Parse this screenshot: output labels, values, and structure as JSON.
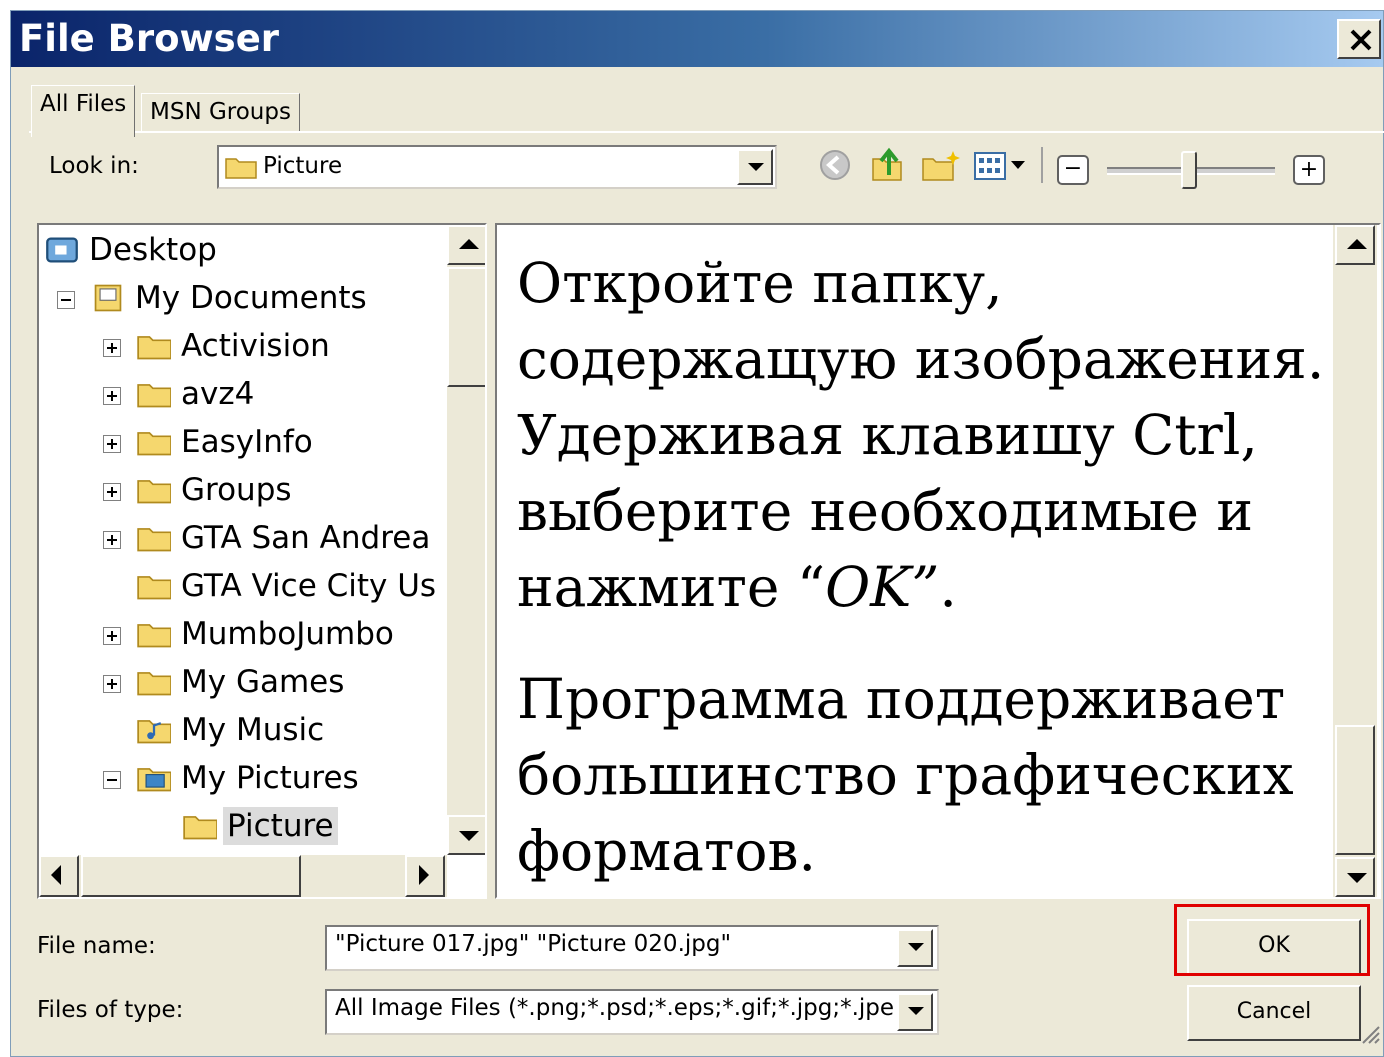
{
  "window": {
    "title": "File Browser",
    "close_glyph": "✕"
  },
  "tabs": [
    {
      "label": "All Files",
      "active": true
    },
    {
      "label": "MSN Groups",
      "active": false
    }
  ],
  "look_in": {
    "label": "Look in:",
    "value": "Picture"
  },
  "toolbar": {
    "icons": [
      "back-icon",
      "up-folder-icon",
      "new-folder-icon",
      "view-menu-icon"
    ],
    "zoom_minus": "−",
    "zoom_plus": "+",
    "zoom_level": 0.45
  },
  "tree": [
    {
      "label": "Desktop",
      "icon": "desktop-icon",
      "expander": "none"
    },
    {
      "label": "My Documents",
      "icon": "documents-icon",
      "expander": "minus"
    },
    {
      "label": "Activision",
      "icon": "folder-icon",
      "expander": "plus"
    },
    {
      "label": "avz4",
      "icon": "folder-icon",
      "expander": "plus"
    },
    {
      "label": "EasyInfo",
      "icon": "folder-icon",
      "expander": "plus"
    },
    {
      "label": "Groups",
      "icon": "folder-icon",
      "expander": "plus"
    },
    {
      "label": "GTA San Andrea",
      "icon": "folder-icon",
      "expander": "plus"
    },
    {
      "label": "GTA Vice City Us",
      "icon": "folder-icon",
      "expander": "none"
    },
    {
      "label": "MumboJumbo",
      "icon": "folder-icon",
      "expander": "plus"
    },
    {
      "label": "My Games",
      "icon": "folder-icon",
      "expander": "plus"
    },
    {
      "label": "My Music",
      "icon": "music-folder-icon",
      "expander": "none"
    },
    {
      "label": "My Pictures",
      "icon": "pictures-folder-icon",
      "expander": "minus"
    },
    {
      "label": "Picture",
      "icon": "folder-icon",
      "expander": "none",
      "selected": true
    }
  ],
  "overlay": {
    "paragraph1_lines": [
      "Откройте папку,",
      "содержащую изображения.",
      "Удерживая клавишу  Ctrl,",
      "выберите необходимые и"
    ],
    "p1_last_prefix": "нажмите “",
    "p1_last_italic": "OK”",
    "p1_last_suffix": ".",
    "paragraph2_lines": [
      "Программа поддерживает",
      "большинство графических",
      "форматов."
    ]
  },
  "file_name": {
    "label": "File name:",
    "value": "\"Picture 017.jpg\" \"Picture 020.jpg\""
  },
  "files_of_type": {
    "label": "Files of type:",
    "value": "All Image Files (*.png;*.psd;*.eps;*.gif;*.jpg;*.jpeg;*.jfif;*."
  },
  "buttons": {
    "ok": "OK",
    "cancel": "Cancel"
  },
  "colors": {
    "title_gradient_start": "#0a246a",
    "highlight": "#e00000",
    "face": "#ece9d8"
  }
}
